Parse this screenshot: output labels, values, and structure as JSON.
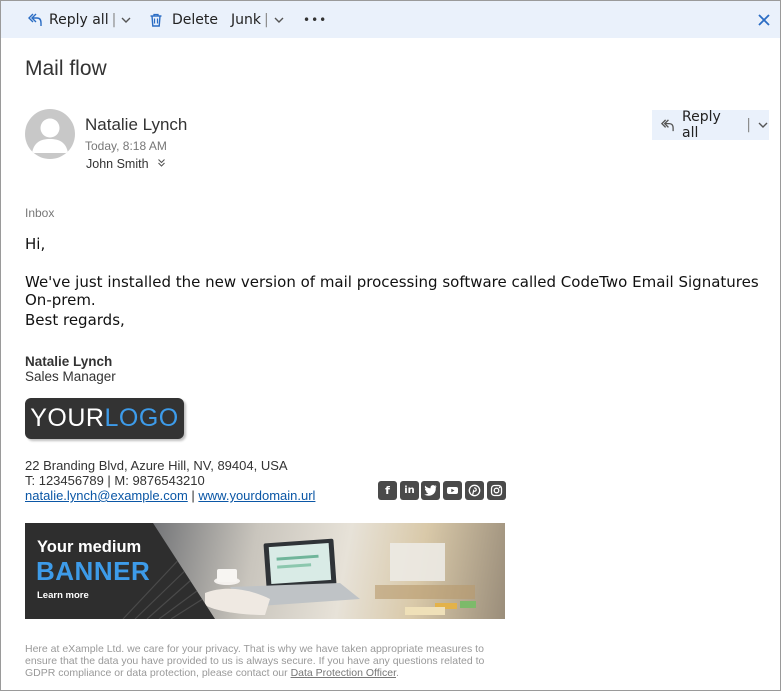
{
  "toolbar": {
    "reply_all": "Reply all",
    "delete": "Delete",
    "junk": "Junk",
    "more": "•••"
  },
  "message": {
    "subject": "Mail flow",
    "sender": "Natalie Lynch",
    "date": "Today, 8:18 AM",
    "to": "John Smith",
    "reply_all": "Reply all",
    "folder": "Inbox",
    "greeting": "Hi,",
    "body": "We've just installed the new version of mail processing software called CodeTwo Email Signatures On-prem.",
    "closing": "Best regards,"
  },
  "signature": {
    "name": "Natalie Lynch",
    "title": "Sales Manager",
    "logo_your": "YOUR",
    "logo_logo": "LOGO",
    "address": "22 Branding Blvd, Azure Hill, NV, 89404, USA",
    "phones": "T: 123456789 | M: 9876543210",
    "email": "natalie.lynch@example.com",
    "separator": " | ",
    "website": "www.yourdomain.url",
    "social": [
      "facebook",
      "linkedin",
      "twitter",
      "youtube",
      "pinterest",
      "instagram"
    ]
  },
  "banner": {
    "line1": "Your medium",
    "line2": "BANNER",
    "line3": "Learn more"
  },
  "privacy": {
    "text": "Here at eXample Ltd. we care for your privacy. That is why we have taken appropriate measures to ensure that the data you have provided to us is always secure. If you have any questions related to GDPR compliance or data protection, please contact our ",
    "link": "Data Protection Officer",
    "end": "."
  },
  "colors": {
    "accent": "#2a6cc4",
    "toolbar_bg": "#eaf1fb",
    "logo_bg": "#333333",
    "brand_blue": "#3d9be9"
  }
}
